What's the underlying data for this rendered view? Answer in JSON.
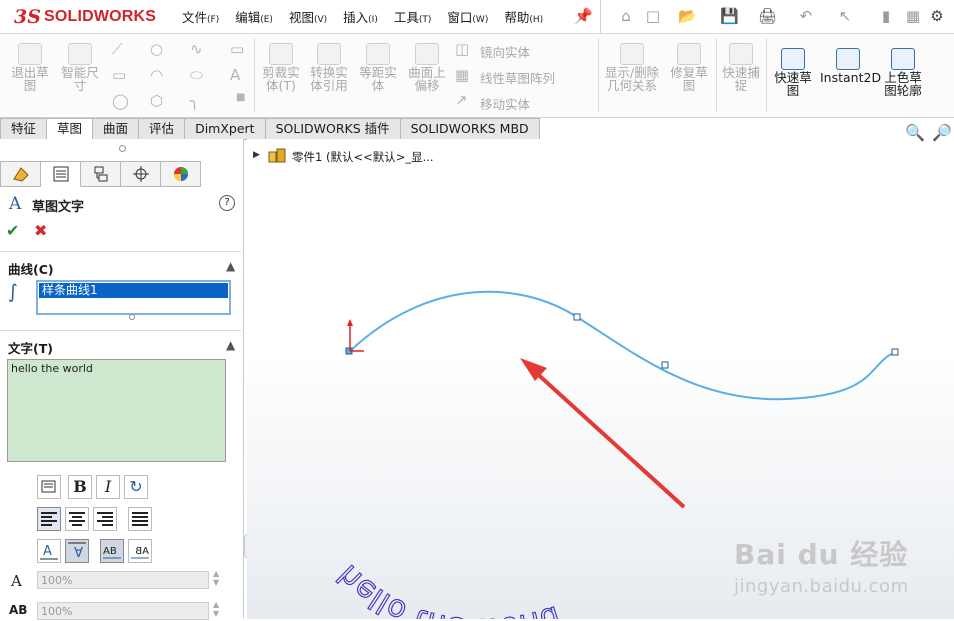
{
  "app": {
    "logo_prefix": "3S",
    "logo_text": "SOLIDWORKS"
  },
  "menu": [
    {
      "label": "文件",
      "key": "(F)"
    },
    {
      "label": "编辑",
      "key": "(E)"
    },
    {
      "label": "视图",
      "key": "(V)"
    },
    {
      "label": "插入",
      "key": "(I)"
    },
    {
      "label": "工具",
      "key": "(T)"
    },
    {
      "label": "窗口",
      "key": "(W)"
    },
    {
      "label": "帮助",
      "key": "(H)"
    }
  ],
  "commands": {
    "exit_sketch": "退出草\n图",
    "smart_dim": "智能尺\n寸",
    "trim": "剪裁实\n体(T)",
    "convert": "转换实\n体引用",
    "offset": "等距实\n体",
    "offset_surface": "曲面上\n偏移",
    "mirror": "镜向实体",
    "linear_pattern": "线性草图阵列",
    "move": "移动实体",
    "display_delete": "显示/删除\n几何关系",
    "repair": "修复草\n图",
    "quick_snap": "快速捕\n捉",
    "rapid_sketch": "快速草\n图",
    "instant2d": "Instant2D",
    "shaded_sketch": "上色草\n图轮廓"
  },
  "tabs": [
    "特征",
    "草图",
    "曲面",
    "评估",
    "DimXpert",
    "SOLIDWORKS 插件",
    "SOLIDWORKS MBD"
  ],
  "active_tab": "草图",
  "tree": {
    "item": "零件1  (默认<<默认>_显..."
  },
  "panel": {
    "title": "草图文字",
    "curves_section": "曲线(C)",
    "curve_item": "样条曲线1",
    "text_section": "文字(T)",
    "text_value": "hello the world",
    "width_factor": "100%",
    "spacing": "100%"
  },
  "canvas_text": "hello the world",
  "colors": {
    "curve": "#5aaee6",
    "text": "#3b2fbf",
    "arrow": "#e53935",
    "selection": "#0a64c8",
    "text_box": "#cde8cf"
  },
  "watermark": {
    "brand": "Bai du 经验",
    "url": "jingyan.baidu.com"
  }
}
